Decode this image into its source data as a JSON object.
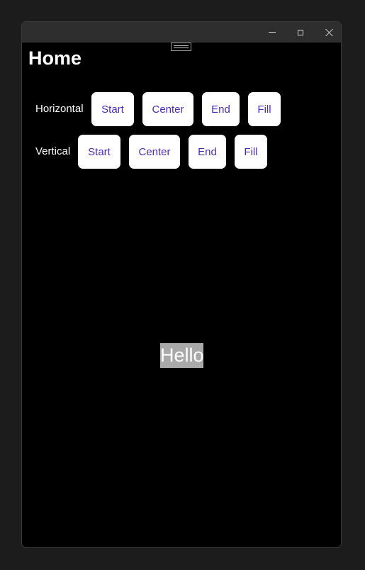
{
  "window": {
    "minimize_glyph": "minimize-icon",
    "maximize_glyph": "maximize-icon",
    "close_glyph": "close-icon"
  },
  "page": {
    "title": "Home"
  },
  "horizontal": {
    "label": "Horizontal",
    "options": [
      "Start",
      "Center",
      "End",
      "Fill"
    ]
  },
  "vertical": {
    "label": "Vertical",
    "options": [
      "Start",
      "Center",
      "End",
      "Fill"
    ]
  },
  "preview": {
    "text": "Hello",
    "background": "#a9a9a9"
  },
  "colors": {
    "window_background": "#000000",
    "titlebar": "#2e2e2e",
    "button_text": "#4b2bb8",
    "button_background": "#ffffff"
  }
}
